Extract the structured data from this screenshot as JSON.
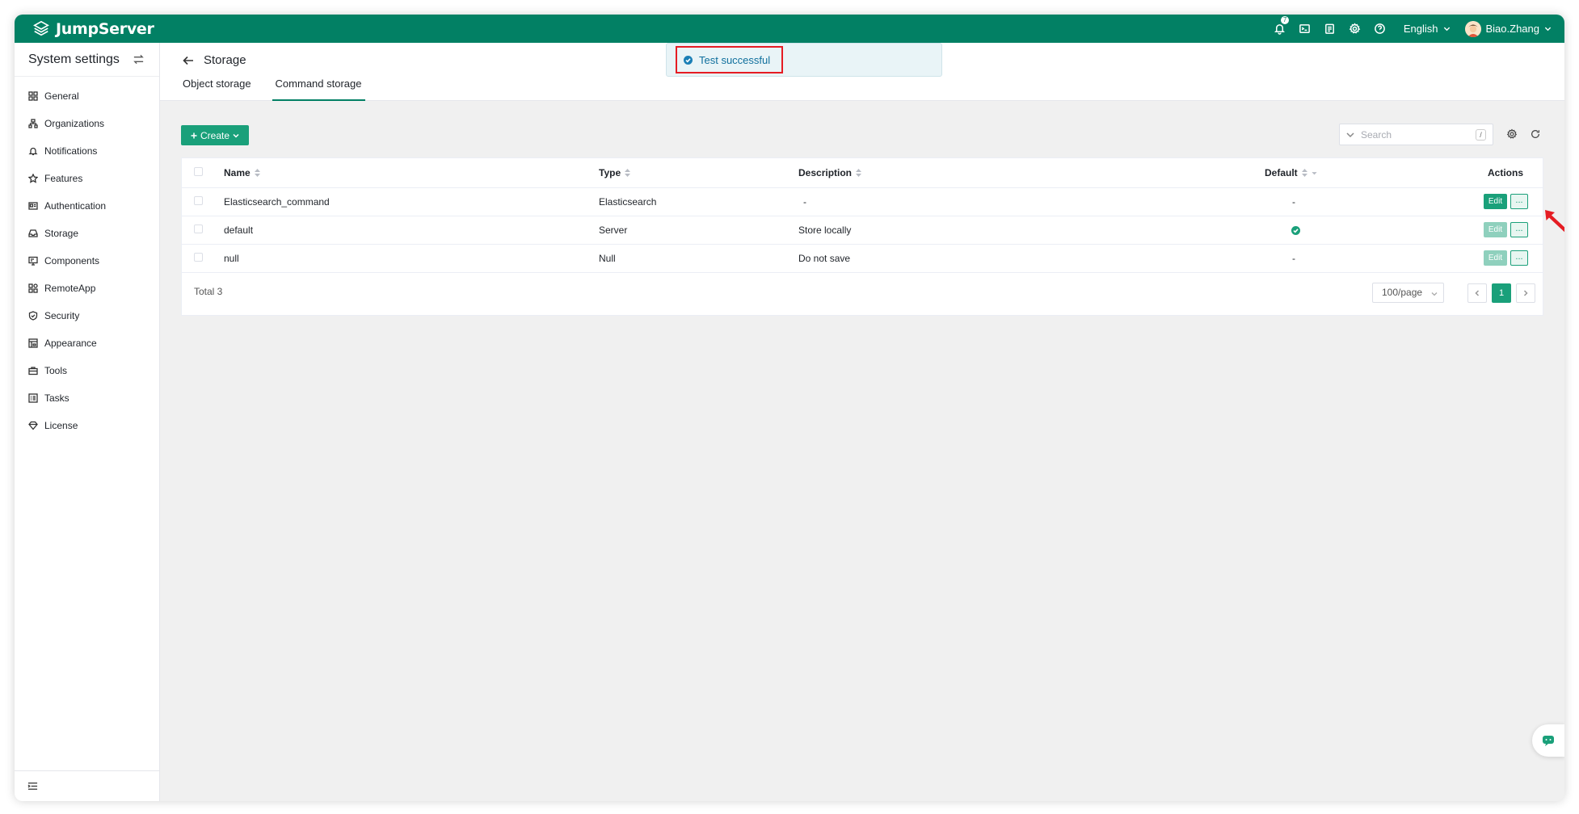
{
  "app": {
    "name": "JumpServer"
  },
  "header": {
    "notification_count": "7",
    "language": "English",
    "user_name": "Biao.Zhang"
  },
  "sidebar": {
    "title": "System settings",
    "items": [
      {
        "label": "General",
        "icon": "grid-icon"
      },
      {
        "label": "Organizations",
        "icon": "org-icon"
      },
      {
        "label": "Notifications",
        "icon": "bell-icon"
      },
      {
        "label": "Features",
        "icon": "star-icon"
      },
      {
        "label": "Authentication",
        "icon": "id-card-icon"
      },
      {
        "label": "Storage",
        "icon": "inbox-icon"
      },
      {
        "label": "Components",
        "icon": "monitor-icon"
      },
      {
        "label": "RemoteApp",
        "icon": "apps-icon"
      },
      {
        "label": "Security",
        "icon": "shield-icon"
      },
      {
        "label": "Appearance",
        "icon": "palette-icon"
      },
      {
        "label": "Tools",
        "icon": "briefcase-icon"
      },
      {
        "label": "Tasks",
        "icon": "list-icon"
      },
      {
        "label": "License",
        "icon": "diamond-icon"
      }
    ]
  },
  "page": {
    "title": "Storage",
    "tabs": [
      {
        "label": "Object storage",
        "active": false
      },
      {
        "label": "Command storage",
        "active": true
      }
    ],
    "create_label": "Create",
    "search_placeholder": "Search",
    "search_shortcut": "/"
  },
  "table": {
    "columns": [
      "Name",
      "Type",
      "Description",
      "Default",
      "Actions"
    ],
    "rows": [
      {
        "name": "Elasticsearch_command",
        "type": "Elasticsearch",
        "description": "-",
        "default": "-",
        "edit": "Edit",
        "more": "..."
      },
      {
        "name": "default",
        "type": "Server",
        "description": "Store locally",
        "default": "yes",
        "edit": "Edit",
        "more": "..."
      },
      {
        "name": "null",
        "type": "Null",
        "description": "Do not save",
        "default": "-",
        "edit": "Edit",
        "more": "..."
      }
    ],
    "total": "Total 3",
    "page_size": "100/page",
    "current_page": "1"
  },
  "toast": {
    "message": "Test successful"
  },
  "colors": {
    "brand": "#028064",
    "primary": "#1aa07a",
    "highlight": "#e51c23"
  }
}
